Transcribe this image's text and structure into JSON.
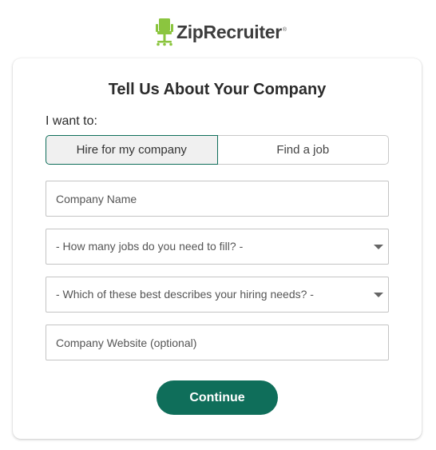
{
  "brand": {
    "name": "ZipRecruiter",
    "registered_mark": "®",
    "accent_color": "#8bc53f",
    "primary_color": "#0f6e5a"
  },
  "form": {
    "title": "Tell Us About Your Company",
    "intent_label": "I want to:",
    "intent_options": [
      {
        "label": "Hire for my company",
        "selected": true
      },
      {
        "label": "Find a job",
        "selected": false
      }
    ],
    "company_name": {
      "placeholder": "Company Name",
      "value": ""
    },
    "jobs_select": {
      "selected": "- How many jobs do you need to fill? -"
    },
    "hiring_needs_select": {
      "selected": "- Which of these best describes your hiring needs? -"
    },
    "website": {
      "placeholder": "Company Website (optional)",
      "value": ""
    },
    "submit_label": "Continue"
  }
}
